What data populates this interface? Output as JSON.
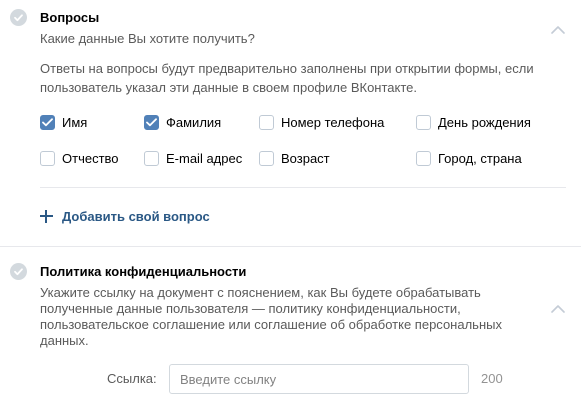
{
  "questions": {
    "title": "Вопросы",
    "subtitle": "Какие данные Вы хотите получить?",
    "hint": "Ответы на вопросы будут предварительно заполнены при открытии формы, если пользователь указал эти данные в своем профиле ВКонтакте.",
    "fields": [
      {
        "label": "Имя",
        "checked": true
      },
      {
        "label": "Фамилия",
        "checked": true
      },
      {
        "label": "Номер телефона",
        "checked": false
      },
      {
        "label": "День рождения",
        "checked": false
      },
      {
        "label": "Отчество",
        "checked": false
      },
      {
        "label": "E-mail адрес",
        "checked": false
      },
      {
        "label": "Возраст",
        "checked": false
      },
      {
        "label": "Город, страна",
        "checked": false
      }
    ],
    "add_question_label": "Добавить свой вопрос"
  },
  "privacy": {
    "title": "Политика конфиденциальности",
    "description": "Укажите ссылку на документ с пояснением, как Вы будете обрабатывать полученные данные пользователя — политику конфиденциальности, пользовательское соглашение или соглашение об обработке персональных данных.",
    "link_label": "Ссылка:",
    "link_placeholder": "Введите ссылку",
    "link_value": "",
    "char_limit": "200"
  },
  "colors": {
    "accent": "#5181b8",
    "link": "#2a5885",
    "muted_text": "#5a5a5a",
    "border": "#d3d9de",
    "divider": "#e7e8ec"
  }
}
